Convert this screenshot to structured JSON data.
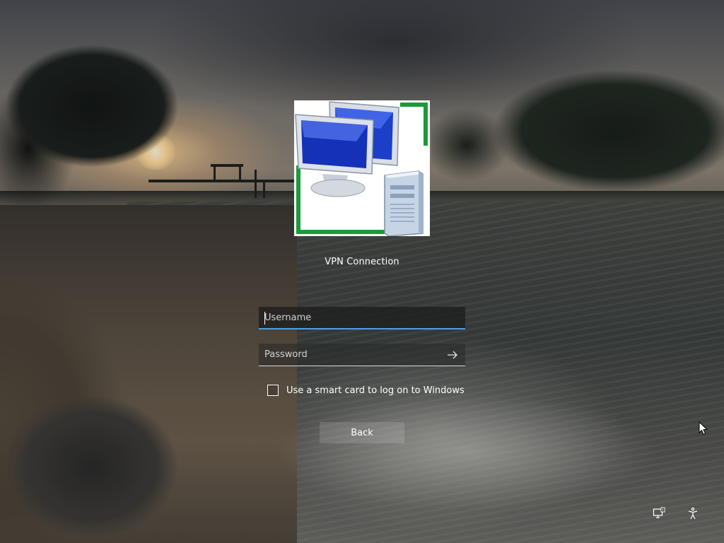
{
  "account": {
    "name": "VPN Connection"
  },
  "login": {
    "username_placeholder": "Username",
    "password_placeholder": "Password",
    "submit_icon": "arrow-right-icon",
    "smartcard_label": "Use a smart card to log on to Windows",
    "smartcard_checked": false,
    "back_label": "Back"
  },
  "tray": {
    "network_icon": "network-icon",
    "accessibility_icon": "accessibility-icon"
  },
  "colors": {
    "focus_underline": "#4f9fe0",
    "text": "#ffffff"
  }
}
